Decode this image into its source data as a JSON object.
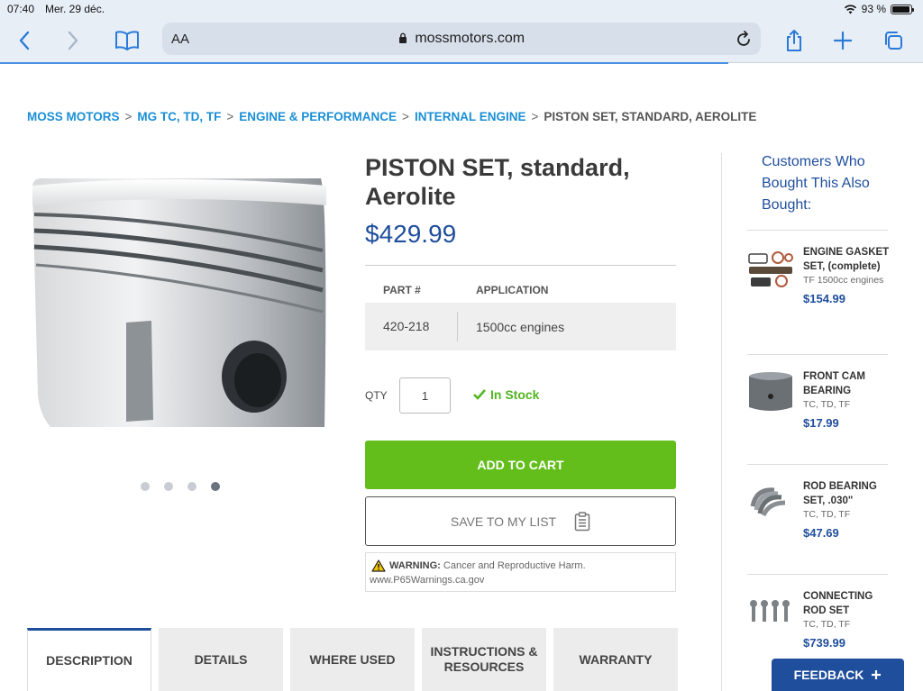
{
  "status_bar": {
    "time": "07:40",
    "date": "Mer. 29 déc.",
    "battery": "93 %",
    "battery_level": 0.93
  },
  "browser": {
    "text_size_label": "AA",
    "url": "mossmotors.com",
    "accent_color": "#2a7bd9"
  },
  "breadcrumb": [
    {
      "label": "MOSS MOTORS"
    },
    {
      "label": "MG TC, TD, TF"
    },
    {
      "label": "ENGINE & PERFORMANCE"
    },
    {
      "label": "INTERNAL ENGINE"
    },
    {
      "label": "PISTON SET, STANDARD, AEROLITE"
    }
  ],
  "carousel": {
    "count": 4,
    "active_index": 3
  },
  "product": {
    "title": "PISTON SET, standard, Aerolite",
    "price": "$429.99",
    "spec_headers": {
      "part": "PART #",
      "application": "APPLICATION"
    },
    "part_number": "420-218",
    "application": "1500cc engines",
    "qty_label": "QTY",
    "qty_value": "1",
    "stock_status": "In Stock",
    "add_to_cart": "ADD TO CART",
    "save_to_list": "SAVE TO MY LIST",
    "warning_label": "WARNING:",
    "warning_text": "Cancer and Reproductive Harm.",
    "warning_link": "www.P65Warnings.ca.gov"
  },
  "tabs": [
    {
      "label": "DESCRIPTION",
      "active": true
    },
    {
      "label": "DETAILS",
      "active": false
    },
    {
      "label": "WHERE USED",
      "active": false
    },
    {
      "label": "INSTRUCTIONS & RESOURCES",
      "active": false
    },
    {
      "label": "WARRANTY",
      "active": false
    }
  ],
  "sidebar": {
    "title": "Customers Who Bought This Also Bought:",
    "items": [
      {
        "name": "ENGINE GASKET SET, (complete)",
        "application": "TF 1500cc engines",
        "price": "$154.99",
        "icon": "gasket-set-image"
      },
      {
        "name": "FRONT CAM BEARING",
        "application": "TC, TD, TF",
        "price": "$17.99",
        "icon": "cam-bearing-image"
      },
      {
        "name": "ROD BEARING SET, .030\"",
        "application": "TC, TD, TF",
        "price": "$47.69",
        "icon": "rod-bearing-image"
      },
      {
        "name": "CONNECTING ROD SET",
        "application": "TC, TD, TF",
        "price": "$739.99",
        "icon": "connecting-rod-image"
      }
    ]
  },
  "feedback": {
    "label": "FEEDBACK",
    "icon": "plus-icon"
  },
  "colors": {
    "brand_blue": "#1f4e9c",
    "link_blue": "#1a8fd6",
    "cart_green": "#63be1c",
    "stock_green": "#52b520"
  }
}
